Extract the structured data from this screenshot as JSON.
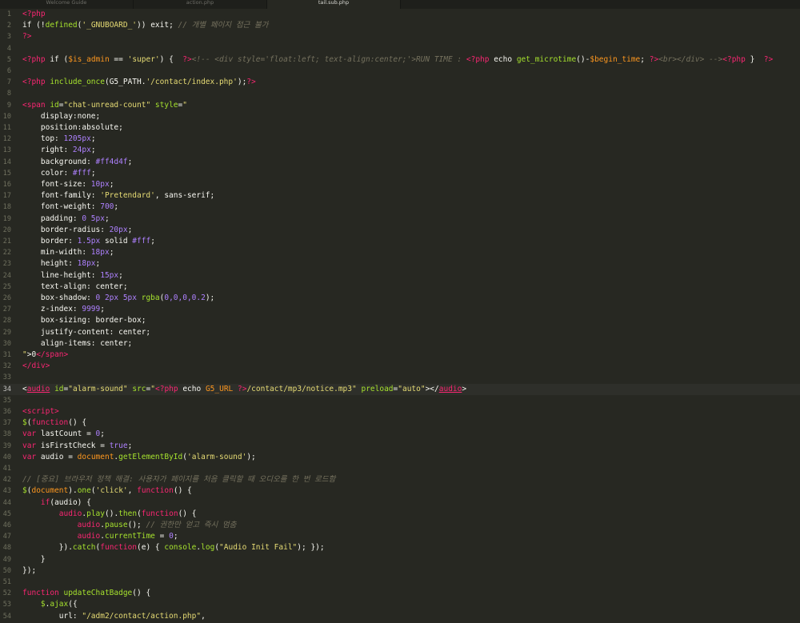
{
  "tabs": [
    {
      "label": "Welcome Guide",
      "active": false
    },
    {
      "label": "action.php",
      "active": false
    },
    {
      "label": "tail.sub.php",
      "active": true
    }
  ],
  "current_line": 34,
  "lines": [
    {
      "n": 1,
      "t": [
        [
          "c-tag",
          "<?php"
        ]
      ]
    },
    {
      "n": 2,
      "t": [
        [
          "c-plain",
          "if (!"
        ],
        [
          "c-fn",
          "defined"
        ],
        [
          "c-plain",
          "("
        ],
        [
          "c-str",
          "'_GNUBOARD_'"
        ],
        [
          "c-plain",
          ")) exit; "
        ],
        [
          "c-com",
          "// 개별 페이지 접근 불가"
        ]
      ]
    },
    {
      "n": 3,
      "t": [
        [
          "c-tag",
          "?>"
        ]
      ]
    },
    {
      "n": 4,
      "t": []
    },
    {
      "n": 5,
      "t": [
        [
          "c-tag",
          "<?php "
        ],
        [
          "c-plain",
          "if ("
        ],
        [
          "c-var",
          "$is_admin"
        ],
        [
          "c-plain",
          " == "
        ],
        [
          "c-str",
          "'super'"
        ],
        [
          "c-plain",
          ") {  "
        ],
        [
          "c-tag",
          "?>"
        ],
        [
          "c-com",
          "<!-- <div style='float:left; text-align:center;'>RUN TIME : "
        ],
        [
          "c-tag",
          "<?php "
        ],
        [
          "c-plain",
          "echo "
        ],
        [
          "c-fn",
          "get_microtime"
        ],
        [
          "c-plain",
          "()-"
        ],
        [
          "c-var",
          "$begin_time"
        ],
        [
          "c-plain",
          "; "
        ],
        [
          "c-tag",
          "?>"
        ],
        [
          "c-com",
          "<br></div> -->"
        ],
        [
          "c-tag",
          "<?php "
        ],
        [
          "c-plain",
          "}  "
        ],
        [
          "c-tag",
          "?>"
        ]
      ]
    },
    {
      "n": 6,
      "t": []
    },
    {
      "n": 7,
      "t": [
        [
          "c-tag",
          "<?php "
        ],
        [
          "c-fn",
          "include_once"
        ],
        [
          "c-plain",
          "(G5_PATH."
        ],
        [
          "c-str",
          "'/contact/index.php'"
        ],
        [
          "c-plain",
          ");"
        ],
        [
          "c-tag",
          "?>"
        ]
      ]
    },
    {
      "n": 8,
      "t": []
    },
    {
      "n": 9,
      "t": [
        [
          "c-tag",
          "<span "
        ],
        [
          "c-attr",
          "id"
        ],
        [
          "c-plain",
          "="
        ],
        [
          "c-str",
          "\"chat-unread-count\""
        ],
        [
          "c-plain",
          " "
        ],
        [
          "c-attr",
          "style"
        ],
        [
          "c-plain",
          "="
        ],
        [
          "c-str",
          "\""
        ]
      ]
    },
    {
      "n": 10,
      "t": [
        [
          "c-plain",
          "    display:none;"
        ]
      ]
    },
    {
      "n": 11,
      "t": [
        [
          "c-plain",
          "    position:absolute;"
        ]
      ]
    },
    {
      "n": 12,
      "t": [
        [
          "c-plain",
          "    top: "
        ],
        [
          "c-num",
          "1205px"
        ],
        [
          "c-plain",
          ";"
        ]
      ]
    },
    {
      "n": 13,
      "t": [
        [
          "c-plain",
          "    right: "
        ],
        [
          "c-num",
          "24px"
        ],
        [
          "c-plain",
          ";"
        ]
      ]
    },
    {
      "n": 14,
      "t": [
        [
          "c-plain",
          "    background: "
        ],
        [
          "c-num",
          "#ff4d4f"
        ],
        [
          "c-plain",
          ";"
        ]
      ]
    },
    {
      "n": 15,
      "t": [
        [
          "c-plain",
          "    color: "
        ],
        [
          "c-num",
          "#fff"
        ],
        [
          "c-plain",
          ";"
        ]
      ]
    },
    {
      "n": 16,
      "t": [
        [
          "c-plain",
          "    font-size: "
        ],
        [
          "c-num",
          "10px"
        ],
        [
          "c-plain",
          ";"
        ]
      ]
    },
    {
      "n": 17,
      "t": [
        [
          "c-plain",
          "    font-family: "
        ],
        [
          "c-str",
          "'Pretendard'"
        ],
        [
          "c-plain",
          ", sans-serif;"
        ]
      ]
    },
    {
      "n": 18,
      "t": [
        [
          "c-plain",
          "    font-weight: "
        ],
        [
          "c-num",
          "700"
        ],
        [
          "c-plain",
          ";"
        ]
      ]
    },
    {
      "n": 19,
      "t": [
        [
          "c-plain",
          "    padding: "
        ],
        [
          "c-num",
          "0 5px"
        ],
        [
          "c-plain",
          ";"
        ]
      ]
    },
    {
      "n": 20,
      "t": [
        [
          "c-plain",
          "    border-radius: "
        ],
        [
          "c-num",
          "20px"
        ],
        [
          "c-plain",
          ";"
        ]
      ]
    },
    {
      "n": 21,
      "t": [
        [
          "c-plain",
          "    border: "
        ],
        [
          "c-num",
          "1.5px"
        ],
        [
          "c-plain",
          " solid "
        ],
        [
          "c-num",
          "#fff"
        ],
        [
          "c-plain",
          ";"
        ]
      ]
    },
    {
      "n": 22,
      "t": [
        [
          "c-plain",
          "    min-width: "
        ],
        [
          "c-num",
          "18px"
        ],
        [
          "c-plain",
          ";"
        ]
      ]
    },
    {
      "n": 23,
      "t": [
        [
          "c-plain",
          "    height: "
        ],
        [
          "c-num",
          "18px"
        ],
        [
          "c-plain",
          ";"
        ]
      ]
    },
    {
      "n": 24,
      "t": [
        [
          "c-plain",
          "    line-height: "
        ],
        [
          "c-num",
          "15px"
        ],
        [
          "c-plain",
          ";"
        ]
      ]
    },
    {
      "n": 25,
      "t": [
        [
          "c-plain",
          "    text-align: center;"
        ]
      ]
    },
    {
      "n": 26,
      "t": [
        [
          "c-plain",
          "    box-shadow: "
        ],
        [
          "c-num",
          "0 2px 5px "
        ],
        [
          "c-fn",
          "rgba"
        ],
        [
          "c-plain",
          "("
        ],
        [
          "c-num",
          "0,0,0,0.2"
        ],
        [
          "c-plain",
          ");"
        ]
      ]
    },
    {
      "n": 27,
      "t": [
        [
          "c-plain",
          "    z-index: "
        ],
        [
          "c-num",
          "9999"
        ],
        [
          "c-plain",
          ";"
        ]
      ]
    },
    {
      "n": 28,
      "t": [
        [
          "c-plain",
          "    box-sizing: border-box;"
        ]
      ]
    },
    {
      "n": 29,
      "t": [
        [
          "c-plain",
          "    justify-content: center;"
        ]
      ]
    },
    {
      "n": 30,
      "t": [
        [
          "c-plain",
          "    align-items: center;"
        ]
      ]
    },
    {
      "n": 31,
      "t": [
        [
          "c-str",
          "\""
        ],
        [
          "c-plain",
          ">0"
        ],
        [
          "c-tag",
          "</span>"
        ]
      ]
    },
    {
      "n": 32,
      "t": [
        [
          "c-tag",
          "</div>"
        ]
      ]
    },
    {
      "n": 33,
      "t": []
    },
    {
      "n": 34,
      "t": [
        [
          "c-plain",
          "<"
        ],
        [
          "c-tag c-ul",
          "audio"
        ],
        [
          "c-plain",
          " "
        ],
        [
          "c-attr",
          "id"
        ],
        [
          "c-plain",
          "="
        ],
        [
          "c-str",
          "\"alarm-sound\""
        ],
        [
          "c-plain",
          " "
        ],
        [
          "c-attr",
          "src"
        ],
        [
          "c-plain",
          "="
        ],
        [
          "c-str",
          "\""
        ],
        [
          "c-tag",
          "<?php "
        ],
        [
          "c-plain",
          "echo "
        ],
        [
          "c-var",
          "G5_URL"
        ],
        [
          "c-plain",
          " "
        ],
        [
          "c-tag",
          "?>"
        ],
        [
          "c-str",
          "/contact/mp3/notice.mp3\""
        ],
        [
          "c-plain",
          " "
        ],
        [
          "c-attr",
          "preload"
        ],
        [
          "c-plain",
          "="
        ],
        [
          "c-str",
          "\"auto\""
        ],
        [
          "c-plain",
          "></"
        ],
        [
          "c-tag c-ul",
          "audio"
        ],
        [
          "c-plain",
          ">"
        ]
      ]
    },
    {
      "n": 35,
      "t": []
    },
    {
      "n": 36,
      "t": [
        [
          "c-tag",
          "<script>"
        ]
      ]
    },
    {
      "n": 37,
      "t": [
        [
          "c-fn",
          "$"
        ],
        [
          "c-plain",
          "("
        ],
        [
          "c-kw",
          "function"
        ],
        [
          "c-plain",
          "() {"
        ]
      ]
    },
    {
      "n": 38,
      "t": [
        [
          "c-kw",
          "var "
        ],
        [
          "c-plain",
          "lastCount = "
        ],
        [
          "c-num",
          "0"
        ],
        [
          "c-plain",
          ";"
        ]
      ]
    },
    {
      "n": 39,
      "t": [
        [
          "c-kw",
          "var "
        ],
        [
          "c-plain",
          "isFirstCheck = "
        ],
        [
          "c-num",
          "true"
        ],
        [
          "c-plain",
          ";"
        ]
      ]
    },
    {
      "n": 40,
      "t": [
        [
          "c-kw",
          "var "
        ],
        [
          "c-plain",
          "audio = "
        ],
        [
          "c-var",
          "document"
        ],
        [
          "c-plain",
          "."
        ],
        [
          "c-fn",
          "getElementById"
        ],
        [
          "c-plain",
          "("
        ],
        [
          "c-str",
          "'alarm-sound'"
        ],
        [
          "c-plain",
          ");"
        ]
      ]
    },
    {
      "n": 41,
      "t": []
    },
    {
      "n": 42,
      "t": [
        [
          "c-com",
          "// [중요] 브라우저 정책 해결: 사용자가 페이지를 처음 클릭할 때 오디오를 한 번 로드함"
        ]
      ]
    },
    {
      "n": 43,
      "t": [
        [
          "c-fn",
          "$"
        ],
        [
          "c-plain",
          "("
        ],
        [
          "c-var",
          "document"
        ],
        [
          "c-plain",
          ")."
        ],
        [
          "c-fn",
          "one"
        ],
        [
          "c-plain",
          "("
        ],
        [
          "c-str",
          "'click'"
        ],
        [
          "c-plain",
          ", "
        ],
        [
          "c-kw",
          "function"
        ],
        [
          "c-plain",
          "() {"
        ]
      ]
    },
    {
      "n": 44,
      "t": [
        [
          "c-plain",
          "    "
        ],
        [
          "c-kw",
          "if"
        ],
        [
          "c-plain",
          "(audio) {"
        ]
      ]
    },
    {
      "n": 45,
      "t": [
        [
          "c-plain",
          "        "
        ],
        [
          "c-tag",
          "audio"
        ],
        [
          "c-plain",
          "."
        ],
        [
          "c-fn",
          "play"
        ],
        [
          "c-plain",
          "()."
        ],
        [
          "c-fn",
          "then"
        ],
        [
          "c-plain",
          "("
        ],
        [
          "c-kw",
          "function"
        ],
        [
          "c-plain",
          "() {"
        ]
      ]
    },
    {
      "n": 46,
      "t": [
        [
          "c-plain",
          "            "
        ],
        [
          "c-tag",
          "audio"
        ],
        [
          "c-plain",
          "."
        ],
        [
          "c-fn",
          "pause"
        ],
        [
          "c-plain",
          "(); "
        ],
        [
          "c-com",
          "// 권한만 얻고 즉시 멈춤"
        ]
      ]
    },
    {
      "n": 47,
      "t": [
        [
          "c-plain",
          "            "
        ],
        [
          "c-tag",
          "audio"
        ],
        [
          "c-plain",
          "."
        ],
        [
          "c-fn",
          "currentTime"
        ],
        [
          "c-plain",
          " = "
        ],
        [
          "c-num",
          "0"
        ],
        [
          "c-plain",
          ";"
        ]
      ]
    },
    {
      "n": 48,
      "t": [
        [
          "c-plain",
          "        })."
        ],
        [
          "c-fn",
          "catch"
        ],
        [
          "c-plain",
          "("
        ],
        [
          "c-kw",
          "function"
        ],
        [
          "c-plain",
          "(e) { "
        ],
        [
          "c-fn",
          "console"
        ],
        [
          "c-plain",
          "."
        ],
        [
          "c-fn",
          "log"
        ],
        [
          "c-plain",
          "("
        ],
        [
          "c-str",
          "\"Audio Init Fail\""
        ],
        [
          "c-plain",
          "); });"
        ]
      ]
    },
    {
      "n": 49,
      "t": [
        [
          "c-plain",
          "    }"
        ]
      ]
    },
    {
      "n": 50,
      "t": [
        [
          "c-plain",
          "});"
        ]
      ]
    },
    {
      "n": 51,
      "t": []
    },
    {
      "n": 52,
      "t": [
        [
          "c-kw",
          "function "
        ],
        [
          "c-fn",
          "updateChatBadge"
        ],
        [
          "c-plain",
          "() {"
        ]
      ]
    },
    {
      "n": 53,
      "t": [
        [
          "c-plain",
          "    "
        ],
        [
          "c-fn",
          "$"
        ],
        [
          "c-plain",
          "."
        ],
        [
          "c-fn",
          "ajax"
        ],
        [
          "c-plain",
          "({"
        ]
      ]
    },
    {
      "n": 54,
      "t": [
        [
          "c-plain",
          "        url: "
        ],
        [
          "c-str",
          "\"/adm2/contact/action.php\""
        ],
        [
          "c-plain",
          ","
        ]
      ]
    }
  ]
}
